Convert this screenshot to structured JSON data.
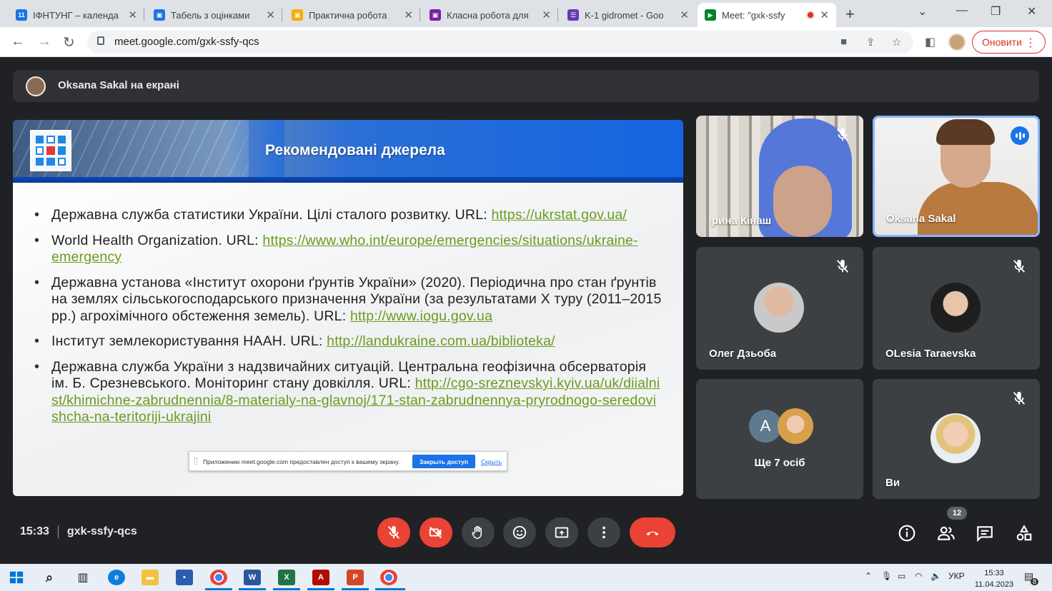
{
  "browser": {
    "tabs": [
      {
        "label": "ІФНТУНГ – календа",
        "favicon": "calendar",
        "color": "#1a73e8",
        "icon_text": "11"
      },
      {
        "label": "Табель з оцінками",
        "favicon": "classroom",
        "color": "#1e8e3e"
      },
      {
        "label": "Практична робота",
        "favicon": "classroom",
        "color": "#f9ab00"
      },
      {
        "label": "Класна робота для",
        "favicon": "classroom",
        "color": "#7b1fa2"
      },
      {
        "label": "K-1 gidromet - Goo",
        "favicon": "forms",
        "color": "#673ab7"
      },
      {
        "label": "Meet: \"gxk-ssfy",
        "favicon": "meet",
        "color": "#00832d",
        "active": true
      }
    ],
    "new_tab_symbol": "+",
    "url": "meet.google.com/gxk-ssfy-qcs",
    "update_button": "Оновити"
  },
  "meet": {
    "presenting_text": "Oksana Sakal на екрані",
    "slide": {
      "title": "Рекомендовані джерела",
      "items": [
        {
          "text": "Державна служба статистики України. Цілі сталого розвитку. URL: ",
          "link": "https://ukrstat.gov.ua/"
        },
        {
          "text": "World Health Organization. URL: ",
          "link": "https://www.who.int/europe/emergencies/situations/ukraine-emergency"
        },
        {
          "text": "Державна установа «Інститут охорони ґрунтів України» (2020). Періодична про стан ґрунтів на землях сільськогосподарського призначення України (за результатами Х туру (2011–2015 рр.) агрохімічного обстеження земель). URL: ",
          "link": "http://www.iogu.gov.ua"
        },
        {
          "text": "Інститут землекористування НААН. URL: ",
          "link": "http://landukraine.com.ua/biblioteka/"
        },
        {
          "text": "Державна служба України з надзвичайних ситуацій. Центральна геофізична обсерваторія ім. Б. Срезневського. Моніторинг стану довкілля. URL: ",
          "link": "http://cgo-sreznevskyi.kyiv.ua/uk/diialnist/khimichne-zabrudnennia/8-materialy-na-glavnoj/171-stan-zabrudnennya-pryrodnogo-seredovishcha-na-teritoriji-ukrajini"
        }
      ]
    },
    "share_popup": {
      "message": "Приложению meet.google.com предоставлен доступ к вашему экрану.",
      "stop_button": "Закрыть доступ",
      "hide_link": "Скрыть"
    },
    "participants": [
      {
        "name": "рина Кінаш",
        "muted": true
      },
      {
        "name": "Oksana Sakal",
        "muted": false,
        "speaking": true
      },
      {
        "name": "Олег Дзьоба",
        "muted": true
      },
      {
        "name": "OLesia Taraevska",
        "muted": true
      },
      {
        "name": "Ще 7 осіб",
        "avatar_letter": "A"
      },
      {
        "name": "Ви",
        "muted": true
      }
    ],
    "time": "15:33",
    "meeting_code": "gxk-ssfy-qcs",
    "people_count": "12",
    "colors": {
      "danger": "#ea4335",
      "control": "#3c4043",
      "active_border": "#8ab4f8"
    }
  },
  "taskbar": {
    "apps": [
      "windows-start",
      "search",
      "task-view",
      "edge",
      "file-explorer",
      "save",
      "chrome",
      "word",
      "excel",
      "acrobat",
      "powerpoint",
      "chrome-active"
    ],
    "language": "УКР",
    "time": "15:33",
    "date": "11.04.2023",
    "notification_count": "8"
  }
}
